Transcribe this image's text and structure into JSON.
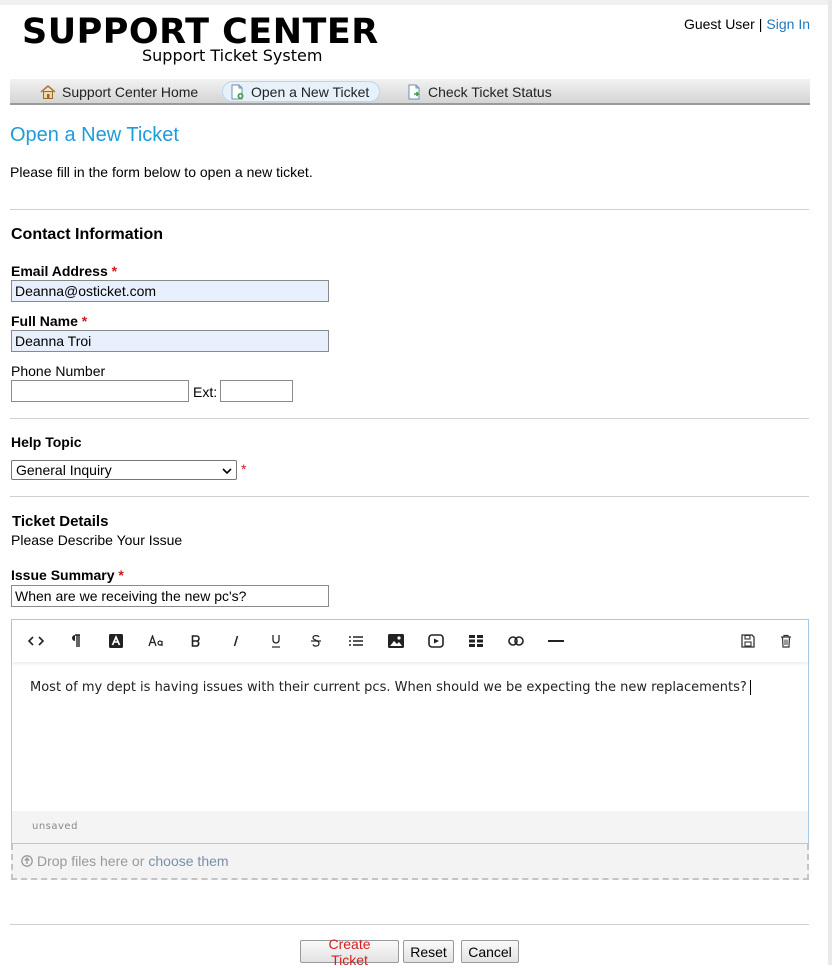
{
  "header": {
    "logo_title": "SUPPORT CENTER",
    "logo_subtitle": "Support Ticket System",
    "user_label": "Guest User",
    "separator": "|",
    "signin_label": "Sign In"
  },
  "nav": {
    "items": [
      {
        "label": "Support Center Home",
        "icon": "home-icon"
      },
      {
        "label": "Open a New Ticket",
        "icon": "new-ticket-icon",
        "active": true
      },
      {
        "label": "Check Ticket Status",
        "icon": "ticket-status-icon"
      }
    ]
  },
  "page": {
    "title": "Open a New Ticket",
    "intro": "Please fill in the form below to open a new ticket."
  },
  "contact": {
    "title": "Contact Information",
    "email_label": "Email Address",
    "email_value": "Deanna@osticket.com",
    "name_label": "Full Name",
    "name_value": "Deanna Troi",
    "phone_label": "Phone Number",
    "phone_value": "",
    "ext_label": "Ext:",
    "ext_value": "",
    "required_mark": "*"
  },
  "help_topic": {
    "label": "Help Topic",
    "selected": "General Inquiry"
  },
  "ticket": {
    "title": "Ticket Details",
    "subtitle": "Please Describe Your Issue",
    "summary_label": "Issue Summary",
    "summary_value": "When are we receiving the new pc's?",
    "body": "Most of my dept is having issues with their current pcs. When should we be expecting the new replacements?",
    "status": "unsaved",
    "toolbar": [
      "html-icon",
      "paragraph-icon",
      "text-color-icon",
      "font-size-icon",
      "bold-icon",
      "italic-icon",
      "underline-icon",
      "strikethrough-icon",
      "list-icon",
      "image-icon",
      "video-icon",
      "table-icon",
      "link-icon",
      "horizontal-rule-icon",
      "save-draft-icon",
      "delete-draft-icon"
    ]
  },
  "attachments": {
    "drop_text": "Drop files here or",
    "choose_text": "choose them"
  },
  "buttons": {
    "create": "Create Ticket",
    "reset": "Reset",
    "cancel": "Cancel"
  },
  "colors": {
    "accent": "#1e9cd7",
    "link": "#1f79c0",
    "required": "#d01818",
    "autofill": "#e8f0fe"
  }
}
